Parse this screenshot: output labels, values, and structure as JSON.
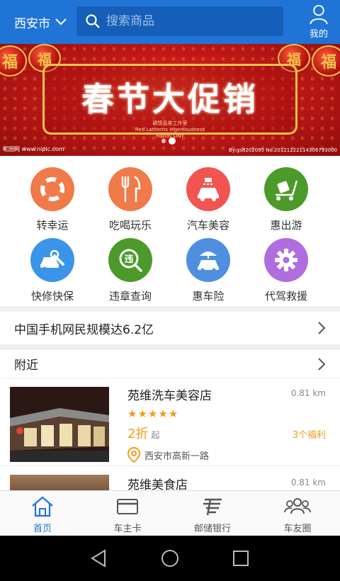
{
  "header": {
    "city": "西安市",
    "search_placeholder": "搜索商品",
    "me_label": "我的",
    "bg_color": "#1f74d6"
  },
  "banner": {
    "headline": "春节大促销",
    "studio_line1": "颖悟品茶工作室",
    "studio_line2": "Red Lanterns Ingeniousness",
    "studio_line3": "Handy  ONY",
    "lantern_char": "福",
    "watermark_left": "昵图网 www.nipic.com",
    "watermark_right": "By:gs8202095  No.20121222114306793000",
    "slide_count": 2,
    "active_slide": 2
  },
  "grid": [
    {
      "label": "转幸运",
      "icon": "lifebuoy-icon",
      "color": "#f07a4a"
    },
    {
      "label": "吃喝玩乐",
      "icon": "fork-knife-icon",
      "color": "#f07a4a"
    },
    {
      "label": "汽车美容",
      "icon": "car-wash-icon",
      "color": "#f25450"
    },
    {
      "label": "惠出游",
      "icon": "luggage-cart-icon",
      "color": "#4c9a2a"
    },
    {
      "label": "快修快保",
      "icon": "car-wrench-icon",
      "color": "#3a95e8"
    },
    {
      "label": "违章查询",
      "icon": "violation-search-icon",
      "color": "#4c9a2a"
    },
    {
      "label": "惠车险",
      "icon": "car-umbrella-icon",
      "color": "#4e8fe0"
    },
    {
      "label": "代驾救援",
      "icon": "gear-icon",
      "color": "#b06de0"
    }
  ],
  "notice": {
    "text": "中国手机网民规模达6.2亿"
  },
  "nearby": {
    "title": "附近",
    "shops": [
      {
        "name": "苑维洗车美容店",
        "distance": "0.81 km",
        "stars": "★★★★★",
        "discount": "2折",
        "discount_suffix": "起",
        "benefit": "3个福利",
        "address": "西安市高新一路"
      },
      {
        "name": "苑维美食店",
        "distance": "0.81 km"
      }
    ]
  },
  "tabbar": [
    {
      "label": "首页",
      "icon": "home-icon",
      "active": true
    },
    {
      "label": "车主卡",
      "icon": "card-icon",
      "active": false
    },
    {
      "label": "邮储银行",
      "icon": "postal-bank-icon",
      "active": false
    },
    {
      "label": "车友圈",
      "icon": "friends-icon",
      "active": false
    }
  ],
  "accent_orange": "#f39a1a"
}
